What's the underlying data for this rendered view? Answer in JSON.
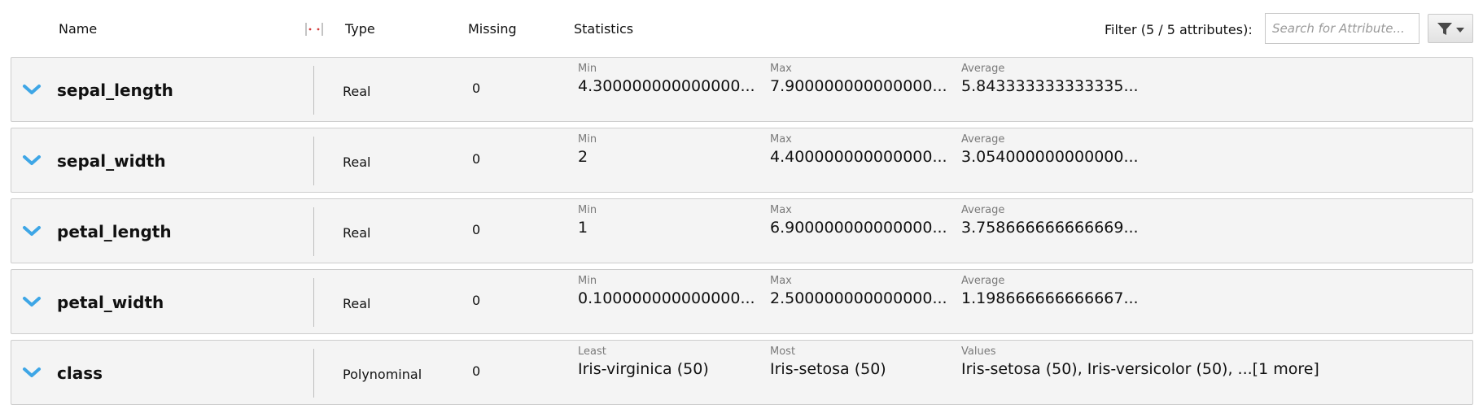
{
  "header": {
    "name": "Name",
    "type": "Type",
    "missing": "Missing",
    "statistics": "Statistics",
    "filter_label": "Filter (5 / 5 attributes):",
    "search_placeholder": "Search for Attribute..."
  },
  "colors": {
    "chevron": "#3ea6e6",
    "row_bg": "#f4f4f4",
    "resize_marker": "#d23c3c"
  },
  "rows": [
    {
      "name": "sepal_length",
      "type": "Real",
      "missing": "0",
      "stats": [
        {
          "label": "Min",
          "value": "4.300000000000000..."
        },
        {
          "label": "Max",
          "value": "7.900000000000000..."
        },
        {
          "label": "Average",
          "value": "5.843333333333335..."
        }
      ]
    },
    {
      "name": "sepal_width",
      "type": "Real",
      "missing": "0",
      "stats": [
        {
          "label": "Min",
          "value": "2"
        },
        {
          "label": "Max",
          "value": "4.400000000000000..."
        },
        {
          "label": "Average",
          "value": "3.054000000000000..."
        }
      ]
    },
    {
      "name": "petal_length",
      "type": "Real",
      "missing": "0",
      "stats": [
        {
          "label": "Min",
          "value": "1"
        },
        {
          "label": "Max",
          "value": "6.900000000000000..."
        },
        {
          "label": "Average",
          "value": "3.758666666666669..."
        }
      ]
    },
    {
      "name": "petal_width",
      "type": "Real",
      "missing": "0",
      "stats": [
        {
          "label": "Min",
          "value": "0.100000000000000..."
        },
        {
          "label": "Max",
          "value": "2.500000000000000..."
        },
        {
          "label": "Average",
          "value": "1.198666666666667..."
        }
      ]
    },
    {
      "name": "class",
      "type": "Polynominal",
      "missing": "0",
      "stats": [
        {
          "label": "Least",
          "value": "Iris-virginica (50)"
        },
        {
          "label": "Most",
          "value": "Iris-setosa (50)"
        },
        {
          "label": "Values",
          "value": "Iris-setosa (50), Iris-versicolor (50), ...[1 more]"
        }
      ]
    }
  ]
}
